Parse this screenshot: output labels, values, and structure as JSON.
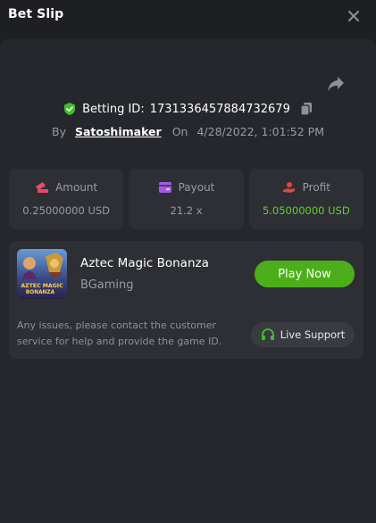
{
  "header": {
    "title": "Bet Slip",
    "close_icon": "close-icon"
  },
  "bet": {
    "betting_id_label": "Betting ID:",
    "betting_id": "1731336457884732679",
    "by_label": "By",
    "username": "Satoshimaker",
    "on_label": "On",
    "datetime": "4/28/2022, 1:01:52 PM"
  },
  "stats": {
    "amount": {
      "label": "Amount",
      "value": "0.25000000 USD",
      "icon": "bet-chips-icon"
    },
    "payout": {
      "label": "Payout",
      "value": "21.2 x",
      "icon": "wallet-icon"
    },
    "profit": {
      "label": "Profit",
      "value": "5.05000000 USD",
      "icon": "profit-hand-icon"
    }
  },
  "game": {
    "name": "Aztec Magic Bonanza",
    "provider": "BGaming",
    "thumbnail_text_line1": "AZTEC MAGIC",
    "thumbnail_text_line2": "BONANZA",
    "play_label": "Play Now",
    "issue_text": "Any issues, please contact the customer service for help and provide the game ID.",
    "support_label": "Live Support"
  },
  "colors": {
    "background": "#1e1f23",
    "panel": "#25272c",
    "card": "#2d2f35",
    "accent_green": "#4cae1a",
    "profit_green": "#5fd31f",
    "amount_icon": "#e84a6a",
    "payout_icon": "#a65ce0",
    "profit_icon": "#e04646"
  }
}
